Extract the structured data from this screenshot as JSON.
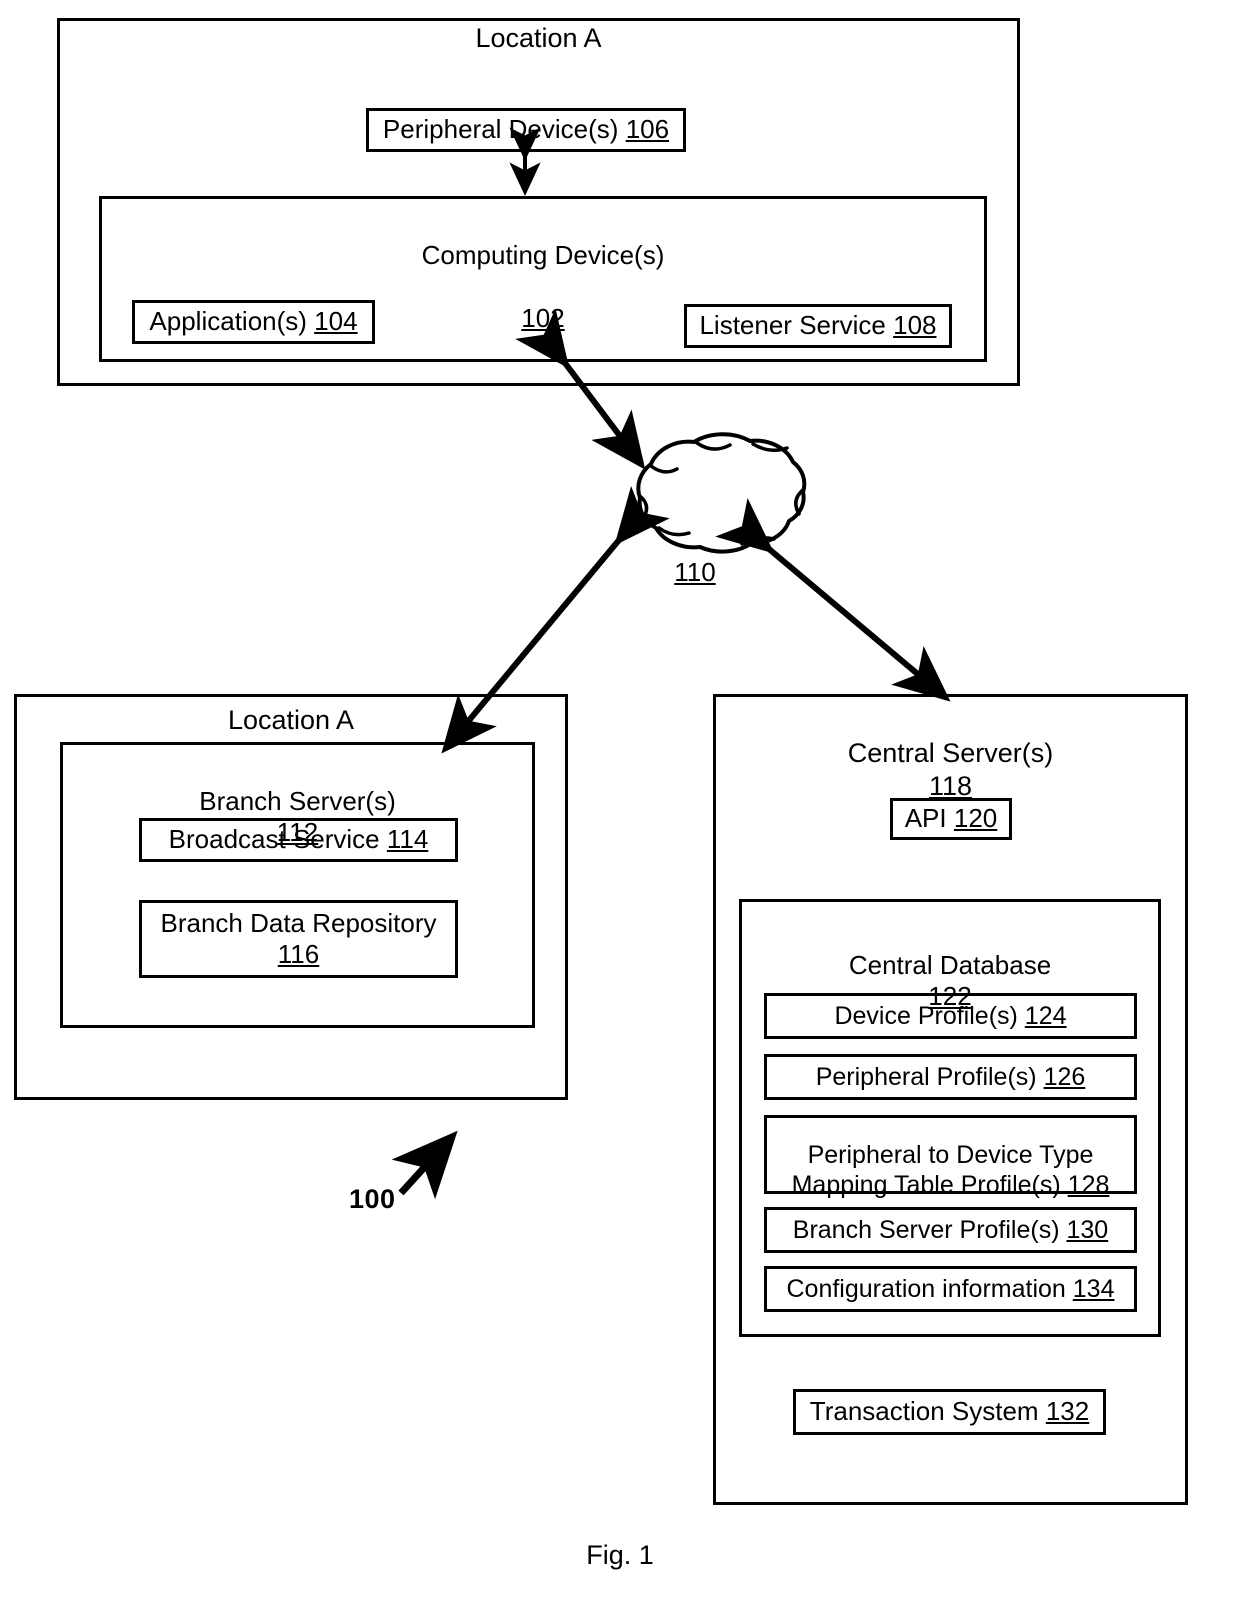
{
  "figure": {
    "caption": "Fig. 1",
    "system_reference": "100"
  },
  "top_location": {
    "title": "Location A",
    "peripheral_device": {
      "label": "Peripheral Device(s)",
      "ref": "106"
    },
    "computing_device": {
      "label": "Computing Device(s)",
      "ref": "102"
    },
    "application": {
      "label": "Application(s)",
      "ref": "104"
    },
    "listener_service": {
      "label": "Listener Service",
      "ref": "108"
    }
  },
  "network": {
    "label": "Network",
    "ref": "110"
  },
  "branch_location": {
    "title": "Location A",
    "branch_server": {
      "label": "Branch Server(s)",
      "ref": "112"
    },
    "broadcast_service": {
      "label": "Broadcast Service",
      "ref": "114"
    },
    "branch_data_repository": {
      "label": "Branch Data Repository",
      "ref": "116"
    }
  },
  "central_server": {
    "title": "Central Server(s)",
    "ref": "118",
    "api": {
      "label": "API",
      "ref": "120"
    },
    "central_database": {
      "label": "Central Database",
      "ref": "122",
      "entries": [
        {
          "label": "Device Profile(s)",
          "ref": "124"
        },
        {
          "label": "Peripheral Profile(s)",
          "ref": "126"
        },
        {
          "label": "Peripheral to Device Type\nMapping Table Profile(s)",
          "ref": "128"
        },
        {
          "label": "Branch Server Profile(s)",
          "ref": "130"
        },
        {
          "label": "Configuration information",
          "ref": "134"
        }
      ]
    },
    "transaction_system": {
      "label": "Transaction System",
      "ref": "132"
    }
  },
  "connections": [
    {
      "name": "peripheral-to-computing",
      "type": "double-arrow"
    },
    {
      "name": "computing-to-network",
      "type": "double-arrow"
    },
    {
      "name": "network-to-branch-server",
      "type": "double-arrow"
    },
    {
      "name": "network-to-central-server",
      "type": "double-arrow"
    },
    {
      "name": "system-pointer",
      "type": "single-arrow"
    }
  ]
}
